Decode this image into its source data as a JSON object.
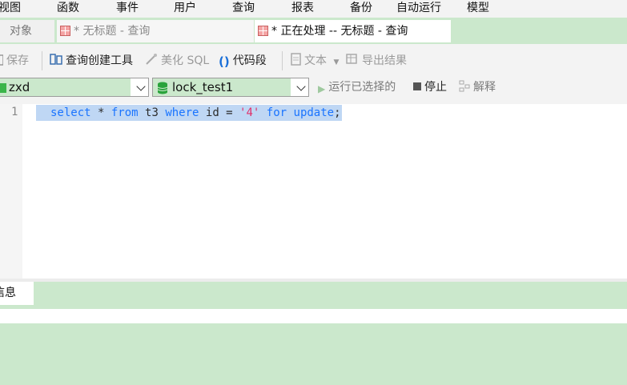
{
  "menu": {
    "items": [
      "视图",
      "函数",
      "事件",
      "用户",
      "查询",
      "报表",
      "备份",
      "自动运行",
      "模型"
    ]
  },
  "tabs": {
    "objects": "对象",
    "query1": "* 无标题 - 查询",
    "query2": "* 正在处理 -- 无标题 - 查询"
  },
  "toolbar": {
    "save": "保存",
    "query_builder": "查询创建工具",
    "beautify_sql": "美化 SQL",
    "code_snippet": "代码段",
    "text": "文本",
    "export_result": "导出结果"
  },
  "connection": {
    "connection_name": "zxd",
    "database": "lock_test1",
    "run_selected": "运行已选择的",
    "stop": "停止",
    "explain": "解释"
  },
  "editor": {
    "line_number": "1",
    "tokens": {
      "t1": "select",
      "t2": " * ",
      "t3": "from",
      "t4": " t3 ",
      "t5": "where",
      "t6": " id = ",
      "t7": "'4'",
      "t8": " ",
      "t9": "for",
      "t10": " ",
      "t11": "update",
      "t12": ";"
    }
  },
  "results": {
    "tab_message": "信息"
  },
  "colors": {
    "accent_green": "#cbe8cc",
    "selection": "#bfd7f4",
    "keyword": "#1a74ff",
    "string": "#e0306a"
  }
}
